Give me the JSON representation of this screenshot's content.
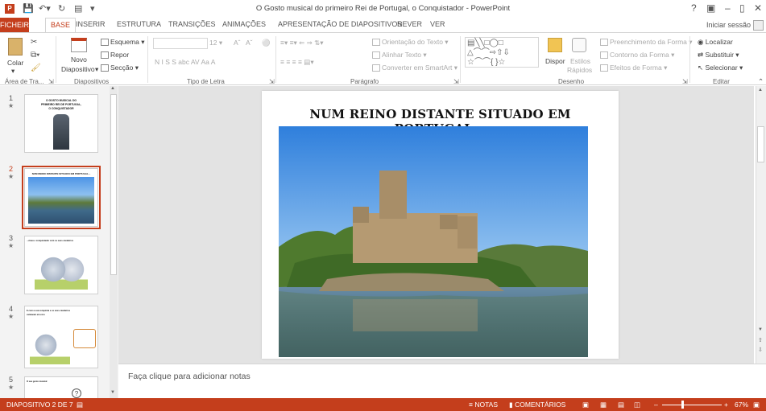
{
  "window": {
    "title": "O Gosto musical do primeiro Rei de Portugal, o Conquistador - PowerPoint",
    "help": "?",
    "login": "Iniciar sessão"
  },
  "tabs": [
    "FICHEIRO",
    "BASE",
    "INSERIR",
    "ESTRUTURA",
    "TRANSIÇÕES",
    "ANIMAÇÕES",
    "APRESENTAÇÃO DE DIAPOSITIVOS",
    "REVER",
    "VER"
  ],
  "ribbon": {
    "clipboard": {
      "paste": "Colar",
      "group": "Área de Tra..."
    },
    "slides": {
      "new_slide": "Novo",
      "new_slide2": "Diapositivo",
      "layout": "Esquema",
      "reset": "Repor",
      "section": "Secção",
      "group": "Diapositivos"
    },
    "font": {
      "size": "12",
      "group": "Tipo de Letra",
      "format_row": "N  I  S  S  abc  AV  Aa  A"
    },
    "paragraph": {
      "text_direction": "Orientação do Texto",
      "align_text": "Alinhar Texto",
      "smartart": "Converter em SmartArt",
      "group": "Parágrafo"
    },
    "drawing": {
      "arrange": "Dispor",
      "quick_styles": "Estilos",
      "quick_styles2": "Rápidos",
      "shape_fill": "Preenchimento da Forma",
      "shape_outline": "Contorno da Forma",
      "shape_effects": "Efeitos de Forma",
      "group": "Desenho"
    },
    "editing": {
      "find": "Localizar",
      "replace": "Substituir",
      "select": "Selecionar",
      "group": "Editar"
    }
  },
  "thumbnails": [
    {
      "num": "1",
      "star": "★",
      "caption_a": "O GOSTO MUSICAL DO",
      "caption_b": "PRIMEIRO REI DE PORTUGAL,",
      "caption_c": "O CONQUISTADOR"
    },
    {
      "num": "2",
      "star": "★",
      "caption_a": "NUM REINO DISTANTE SITUADO EM PORTUGAL..."
    },
    {
      "num": "3",
      "star": "★",
      "caption_a": "...viveu o conquistador com os seus cavaleiros"
    },
    {
      "num": "4",
      "star": "★",
      "caption_a": "E com a sua conquista e os seus cavaleiros",
      "caption_b": "cantavam em coro"
    },
    {
      "num": "5",
      "star": "★",
      "caption_a": "O seu gosto musical"
    }
  ],
  "slide": {
    "title": "NUM REINO DISTANTE SITUADO EM PORTUGAL..."
  },
  "notes": {
    "placeholder": "Faça clique para adicionar notas"
  },
  "status": {
    "slide_count": "DIAPOSITIVO 2 DE 7",
    "notes": "NOTAS",
    "comments": "COMENTÁRIOS",
    "zoom": "67%"
  },
  "colors": {
    "accent": "#c43e1c",
    "sky": "#3f8fe0",
    "water": "#3b6ea5"
  }
}
